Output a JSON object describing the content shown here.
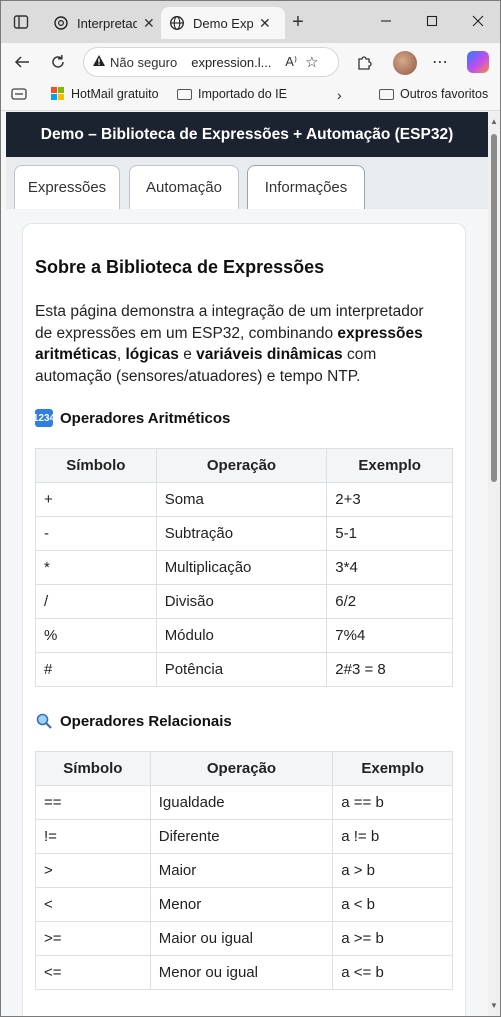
{
  "browser": {
    "tabs": [
      {
        "title": "Interpretado"
      },
      {
        "title": "Demo Expre"
      }
    ],
    "omnibox": {
      "security_label": "Não seguro",
      "url": "expression.l..."
    },
    "favorites": [
      {
        "label": "HotMail gratuito"
      },
      {
        "label": "Importado do IE"
      },
      {
        "label": "Outros favoritos"
      }
    ]
  },
  "app": {
    "header_title": "Demo – Biblioteca de Expressões + Automação (ESP32)",
    "tabs": [
      {
        "label": "Expressões"
      },
      {
        "label": "Automação"
      },
      {
        "label": "Informações"
      }
    ]
  },
  "info": {
    "title": "Sobre a Biblioteca de Expressões",
    "intro_pre": "Esta página demonstra a integração de um interpretador de expressões em um ESP32, combinando ",
    "intro_b1": "expressões aritméticas",
    "intro_sep1": ", ",
    "intro_b2": "lógicas",
    "intro_sep2": " e ",
    "intro_b3": "variáveis dinâmicas",
    "intro_post": " com automação (sensores/atuadores) e tempo NTP.",
    "arith": {
      "heading": "Operadores Aritméticos",
      "columns": [
        "Símbolo",
        "Operação",
        "Exemplo"
      ],
      "rows": [
        [
          "+",
          "Soma",
          "2+3"
        ],
        [
          "-",
          "Subtração",
          "5-1"
        ],
        [
          "*",
          "Multiplicação",
          "3*4"
        ],
        [
          "/",
          "Divisão",
          "6/2"
        ],
        [
          "%",
          "Módulo",
          "7%4"
        ],
        [
          "#",
          "Potência",
          "2#3 = 8"
        ]
      ]
    },
    "rel": {
      "heading": "Operadores Relacionais",
      "columns": [
        "Símbolo",
        "Operação",
        "Exemplo"
      ],
      "rows": [
        [
          "==",
          "Igualdade",
          "a == b"
        ],
        [
          "!=",
          "Diferente",
          "a != b"
        ],
        [
          ">",
          "Maior",
          "a > b"
        ],
        [
          "<",
          "Menor",
          "a < b"
        ],
        [
          ">=",
          "Maior ou igual",
          "a >= b"
        ],
        [
          "<=",
          "Menor ou igual",
          "a <= b"
        ]
      ]
    }
  },
  "colors": {
    "header_bg": "#1c2330",
    "arith_icon": "#2f7fe0",
    "accent": "#f3f5f7"
  },
  "icons": [
    "sidebar-icon",
    "chatgpt-icon",
    "globe-icon",
    "close-icon",
    "plus-icon",
    "minimize-icon",
    "maximize-icon",
    "window-close-icon",
    "back-icon",
    "reload-icon",
    "warning-icon",
    "read-aloud-icon",
    "favorite-star-icon",
    "extensions-icon",
    "copilot-icon",
    "microsoft-icon",
    "folder-icon",
    "chevron-right-icon",
    "numbers-icon",
    "magnifier-icon"
  ]
}
